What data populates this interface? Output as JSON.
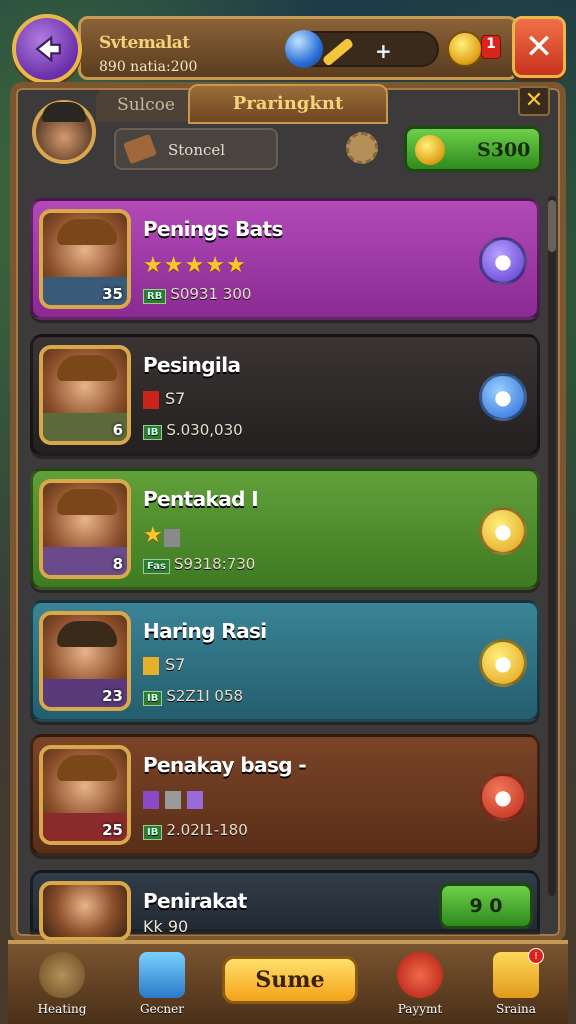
{
  "header": {
    "title": "Svtemalat",
    "subtitle": "890 natia:200",
    "coin_badge": "1",
    "back_icon": "back-arrow-icon",
    "close_icon": "close-icon"
  },
  "tabs": {
    "inactive": "Sulcoe",
    "active": "Praringknt"
  },
  "search": {
    "label": "Stoncel"
  },
  "currency": {
    "value": "S300"
  },
  "cards": [
    {
      "name": "Penings Bats",
      "line2": "",
      "stat_tag": "RB",
      "stat": "S0931 300",
      "level": "35",
      "color": "#9a3aa0",
      "stars": 5
    },
    {
      "name": "Pesingila",
      "line2": "S7",
      "stat_tag": "IB",
      "stat": "S.030,030",
      "level": "6",
      "color": "#2e2a2a",
      "stars": 0
    },
    {
      "name": "Pentakad I",
      "line2": "",
      "stat_tag": "Fas",
      "stat": "S9318:730",
      "level": "8",
      "color": "#4f8a2e",
      "stars": 1
    },
    {
      "name": "Haring Rasi",
      "line2": "S7",
      "stat_tag": "IB",
      "stat": "S2Z1I 058",
      "level": "23",
      "color": "#2f6f80",
      "stars": 1
    },
    {
      "name": "Penakay basg -",
      "line2": "",
      "stat_tag": "IB",
      "stat": "2.02I1-180",
      "level": "25",
      "color": "#6a3a22",
      "stars": 0
    },
    {
      "name": "Penirakat",
      "line2": "Kk 90",
      "stat_tag": "",
      "stat": "",
      "level": "",
      "color": "#2a3440",
      "stars": 0,
      "button": "9 0"
    }
  ],
  "bottom_nav": [
    {
      "label": "Heating",
      "icon": "gear-icon"
    },
    {
      "label": "Gecner",
      "icon": "house-icon"
    },
    {
      "label": "Payymt",
      "icon": "question-icon"
    },
    {
      "label": "Sraina",
      "icon": "flag-icon"
    }
  ],
  "center_button": "Sume",
  "nav_badges": [
    "",
    "",
    "?",
    "!"
  ]
}
